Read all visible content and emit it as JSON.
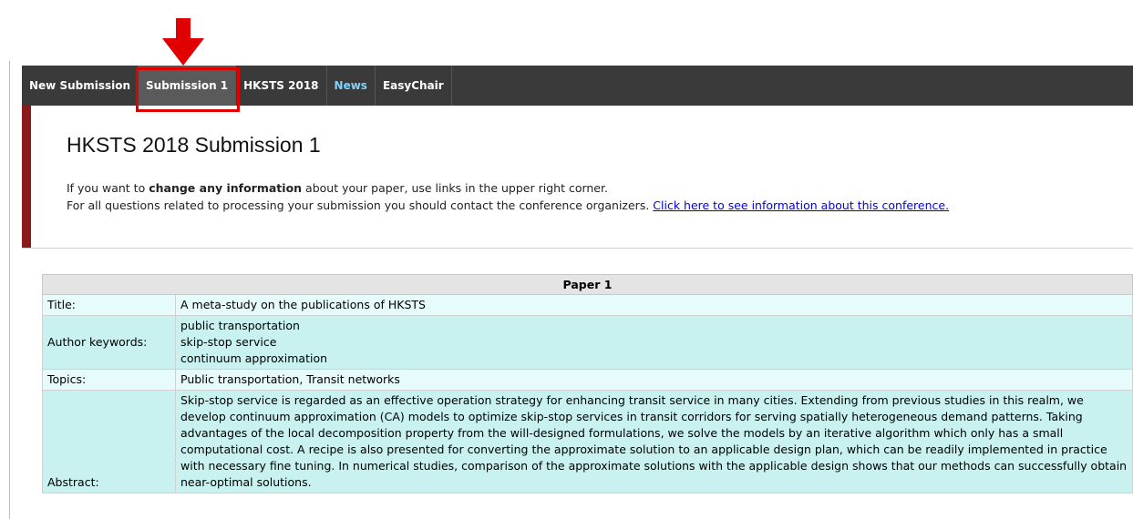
{
  "nav": {
    "tabs": [
      {
        "label": "New Submission"
      },
      {
        "label": "Submission 1"
      },
      {
        "label": "HKSTS 2018"
      },
      {
        "label": "News"
      },
      {
        "label": "EasyChair"
      }
    ]
  },
  "header": {
    "title": "HKSTS 2018 Submission 1",
    "line1_prefix": "If you want to ",
    "line1_bold": "change any information",
    "line1_suffix": " about your paper, use links in the upper right corner.",
    "line2_text": "For all questions related to processing your submission you should contact the conference organizers. ",
    "line2_link": "Click here to see information about this conference."
  },
  "paper": {
    "heading": "Paper 1",
    "title_label": "Title:",
    "title_value": "A meta-study on the publications of HKSTS",
    "keywords_label": "Author keywords:",
    "keywords": [
      "public transportation",
      "skip-stop service",
      "continuum approximation"
    ],
    "topics_label": "Topics:",
    "topics_value": "Public transportation, Transit networks",
    "abstract_label": "Abstract:",
    "abstract_value": "Skip-stop service is regarded as an effective operation strategy for enhancing transit service in many cities. Extending from previous studies in this realm, we develop continuum approximation (CA) models to optimize skip-stop services in transit corridors for serving spatially heterogeneous demand patterns. Taking advantages of the local decomposition property from the will-designed formulations, we solve the models by an iterative algorithm which only has a small computational cost. A recipe is also presented for converting the approximate solution to an applicable design plan, which can be readily implemented in practice with necessary fine tuning. In numerical studies, comparison of the approximate solutions with the applicable design shows that our methods can successfully obtain near-optimal solutions."
  },
  "colors": {
    "navbar": "#3a3a3a",
    "accent_bar": "#8b1a1a",
    "annotation": "#e00000",
    "row_light": "#e6fbfb",
    "row_dark": "#c9f1ef"
  }
}
